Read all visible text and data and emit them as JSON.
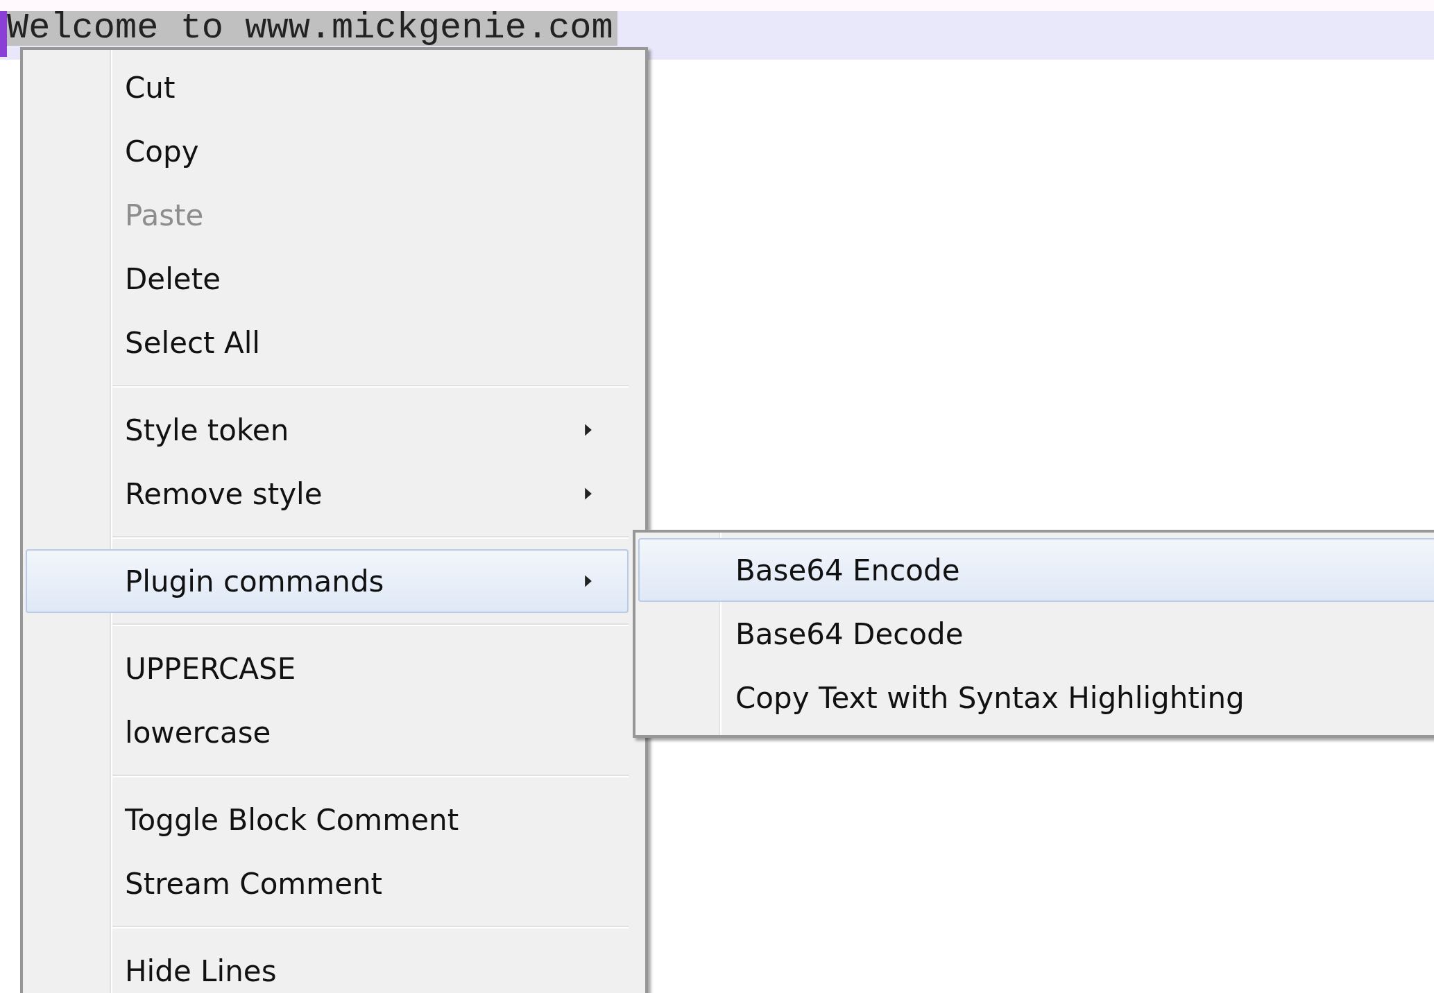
{
  "editor": {
    "line_text": "Welcome to www.mickgenie.com",
    "selected": true
  },
  "context_menu": {
    "items": [
      {
        "kind": "item",
        "label": "Cut",
        "disabled": false
      },
      {
        "kind": "item",
        "label": "Copy",
        "disabled": false
      },
      {
        "kind": "item",
        "label": "Paste",
        "disabled": true
      },
      {
        "kind": "item",
        "label": "Delete",
        "disabled": false
      },
      {
        "kind": "item",
        "label": "Select All",
        "disabled": false
      },
      {
        "kind": "separator"
      },
      {
        "kind": "submenu",
        "label": "Style token",
        "disabled": false,
        "selected": false
      },
      {
        "kind": "submenu",
        "label": "Remove style",
        "disabled": false,
        "selected": false
      },
      {
        "kind": "separator"
      },
      {
        "kind": "submenu",
        "label": "Plugin commands",
        "disabled": false,
        "selected": true
      },
      {
        "kind": "separator"
      },
      {
        "kind": "item",
        "label": "UPPERCASE",
        "disabled": false
      },
      {
        "kind": "item",
        "label": "lowercase",
        "disabled": false
      },
      {
        "kind": "separator"
      },
      {
        "kind": "item",
        "label": "Toggle Block Comment",
        "disabled": false
      },
      {
        "kind": "item",
        "label": "Stream Comment",
        "disabled": false
      },
      {
        "kind": "separator"
      },
      {
        "kind": "item",
        "label": "Hide Lines",
        "disabled": false
      }
    ]
  },
  "submenu": {
    "items": [
      {
        "label": "Base64 Encode",
        "selected": true
      },
      {
        "label": "Base64 Decode",
        "selected": false
      },
      {
        "label": "Copy Text with Syntax Highlighting",
        "selected": false
      }
    ]
  }
}
